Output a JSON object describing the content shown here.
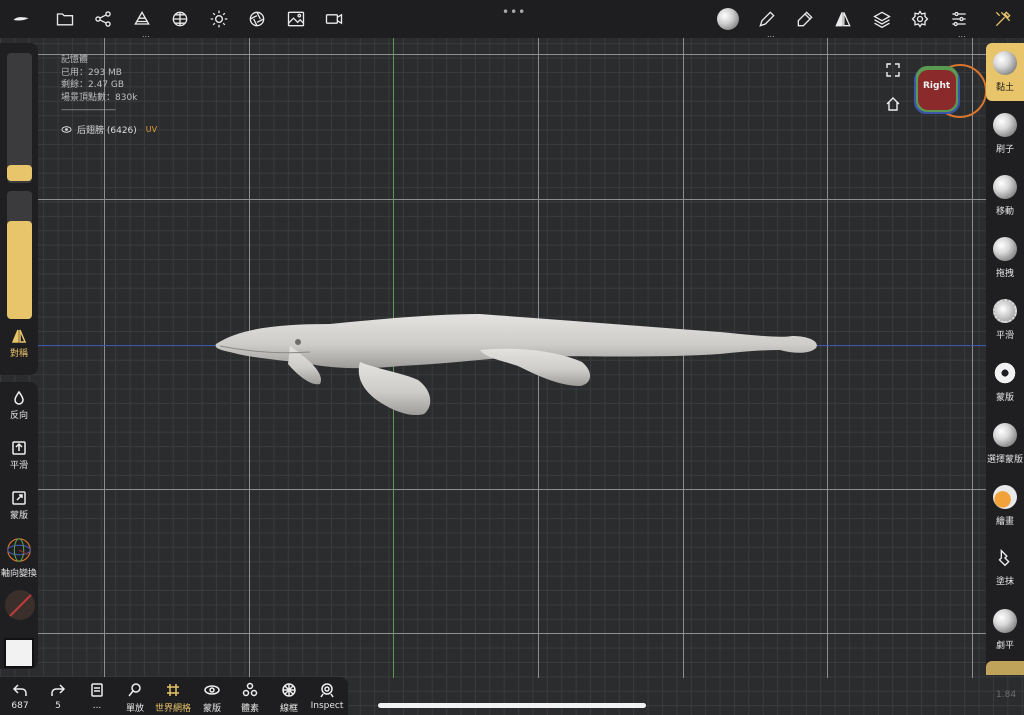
{
  "stats": {
    "memory_label": "記憶體",
    "used": "已用：293 MB",
    "free": "剩餘：2.47 GB",
    "vertices": "場景頂點數：830k",
    "separator": "------------------------"
  },
  "object": {
    "name": "后翅膀 (6426)",
    "uv": "UV"
  },
  "gizmo": {
    "label": "Right"
  },
  "left_panel": {
    "symmetry": "對稱",
    "invert": "反向",
    "smooth": "平滑",
    "mask": "蒙版",
    "axis_transform": "軸向變換"
  },
  "tools": [
    {
      "label": "黏土",
      "active": true
    },
    {
      "label": "刷子"
    },
    {
      "label": "移動"
    },
    {
      "label": "拖拽"
    },
    {
      "label": "平滑"
    },
    {
      "label": "蒙版"
    },
    {
      "label": "選擇蒙版"
    },
    {
      "label": "繪畫"
    },
    {
      "label": "塗抹"
    },
    {
      "label": "劇平"
    }
  ],
  "bottom": {
    "undo_count": "687",
    "redo_count": "5",
    "more": "...",
    "solo": "單放",
    "world_grid": "世界網格",
    "mask_view": "蒙版",
    "voxel": "體素",
    "wireframe": "線框",
    "inspect": "Inspect"
  },
  "version": "1.84",
  "colors": {
    "accent": "#e8c46a",
    "gizmo_red": "#8b2a2a",
    "gizmo_ring": "#d9752b",
    "axis_x": "#3d55a8",
    "axis_y": "#5a9a52"
  }
}
